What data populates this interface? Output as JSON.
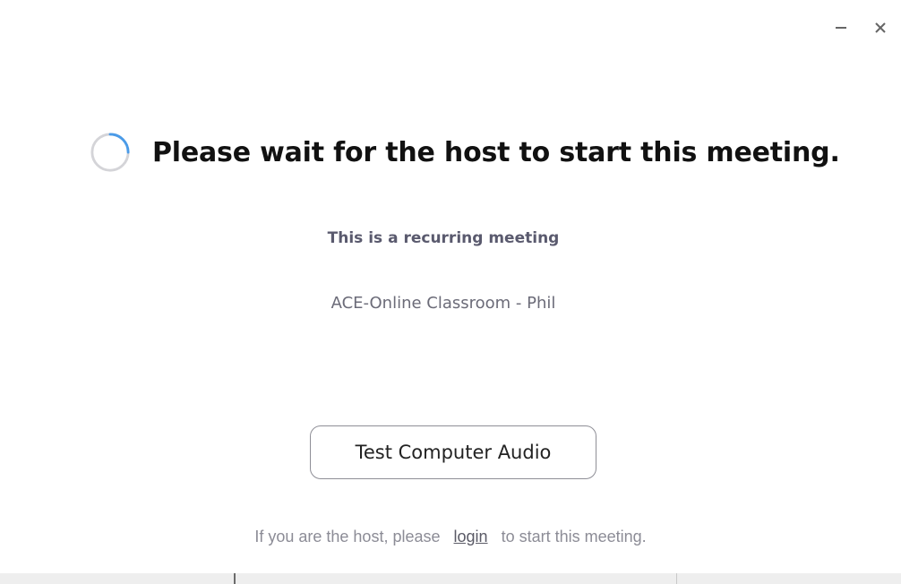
{
  "window": {
    "controls": {
      "minimize_icon": "minimize-icon",
      "close_icon": "close-icon"
    }
  },
  "header": {
    "title": "Please wait for the host to start this meeting.",
    "spinner_icon": "loading-spinner-icon",
    "spinner_color": "#4a9be8"
  },
  "meeting": {
    "recurring_label": "This is a recurring meeting",
    "name": "ACE-Online Classroom - Phil"
  },
  "actions": {
    "test_audio_label": "Test Computer Audio"
  },
  "host_note": {
    "prefix": "If you are the host, please",
    "login_link": "login",
    "suffix": "to start this meeting."
  }
}
